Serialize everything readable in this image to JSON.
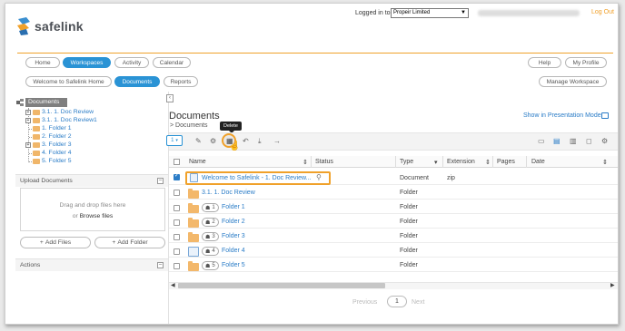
{
  "header": {
    "brand": "safelink",
    "login_label": "Logged in to",
    "login_company": "Propeir Limited",
    "logout": "Log Out"
  },
  "top_nav": [
    "Home",
    "Workspaces",
    "Activity",
    "Calendar"
  ],
  "top_nav_active": "Workspaces",
  "top_right": {
    "help": "Help",
    "profile": "My Profile"
  },
  "sub_nav": [
    "Welcome to Safelink Home",
    "Documents",
    "Reports"
  ],
  "sub_nav_active": "Documents",
  "manage_workspace": "Manage Workspace",
  "tree": {
    "root": "Documents",
    "items": [
      {
        "label": "3.1. 1. Doc Review",
        "expandable": true
      },
      {
        "label": "3.1. 1. Doc Review1",
        "expandable": true
      },
      {
        "label": "1. Folder 1",
        "expandable": false
      },
      {
        "label": "2. Folder 2",
        "expandable": false
      },
      {
        "label": "3. Folder 3",
        "expandable": true
      },
      {
        "label": "4. Folder 4",
        "expandable": false
      },
      {
        "label": "5. Folder 5",
        "expandable": false
      }
    ]
  },
  "upload": {
    "title": "Upload Documents",
    "drop_line1": "Drag and drop files here",
    "drop_or": "or",
    "browse": "Browse files",
    "add_files": "Add Files",
    "add_folder": "Add Folder"
  },
  "actions_title": "Actions",
  "main": {
    "title": "Documents",
    "breadcrumb_sep": ">",
    "breadcrumb": "Documents",
    "presentation_mode": "Show in Presentation Mode",
    "tooltip": "Delete",
    "selected_count": "1"
  },
  "table": {
    "columns": [
      "Name",
      "Status",
      "Type",
      "Extension",
      "Pages",
      "Date"
    ],
    "rows": [
      {
        "name": "Welcome to Safelink - 1. Doc Review...",
        "badge": "",
        "type": "Document",
        "ext": "zip",
        "checked": true,
        "kind": "doc"
      },
      {
        "name": "3.1. 1. Doc Review",
        "badge": "",
        "type": "Folder",
        "ext": "",
        "checked": false,
        "kind": "folder"
      },
      {
        "name": "Folder 1",
        "badge": "1",
        "type": "Folder",
        "ext": "",
        "checked": false,
        "kind": "folder"
      },
      {
        "name": "Folder 2",
        "badge": "2",
        "type": "Folder",
        "ext": "",
        "checked": false,
        "kind": "folder"
      },
      {
        "name": "Folder 3",
        "badge": "3",
        "type": "Folder",
        "ext": "",
        "checked": false,
        "kind": "folder"
      },
      {
        "name": "Folder 4",
        "badge": "4",
        "type": "Folder",
        "ext": "",
        "checked": false,
        "kind": "folder"
      },
      {
        "name": "Folder 5",
        "badge": "5",
        "type": "Folder",
        "ext": "",
        "checked": false,
        "kind": "folder"
      }
    ]
  },
  "pagination": {
    "previous": "Previous",
    "current": "1",
    "next": "Next"
  },
  "colors": {
    "accent": "#2a93d5",
    "highlight": "#f0a12a",
    "link": "#2a7cc7"
  }
}
